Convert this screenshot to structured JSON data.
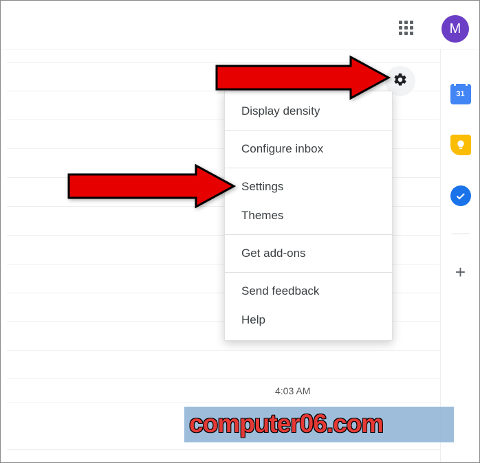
{
  "avatar_initial": "M",
  "settings_menu": {
    "items": [
      {
        "label": "Display density"
      },
      {
        "label": "Configure inbox"
      },
      {
        "label": "Settings"
      },
      {
        "label": "Themes"
      },
      {
        "label": "Get add-ons"
      },
      {
        "label": "Send feedback"
      },
      {
        "label": "Help"
      }
    ]
  },
  "side_panel": {
    "calendar_day": "31"
  },
  "timestamps": {
    "row1": "4:03 AM"
  },
  "watermark": "computer06.com"
}
